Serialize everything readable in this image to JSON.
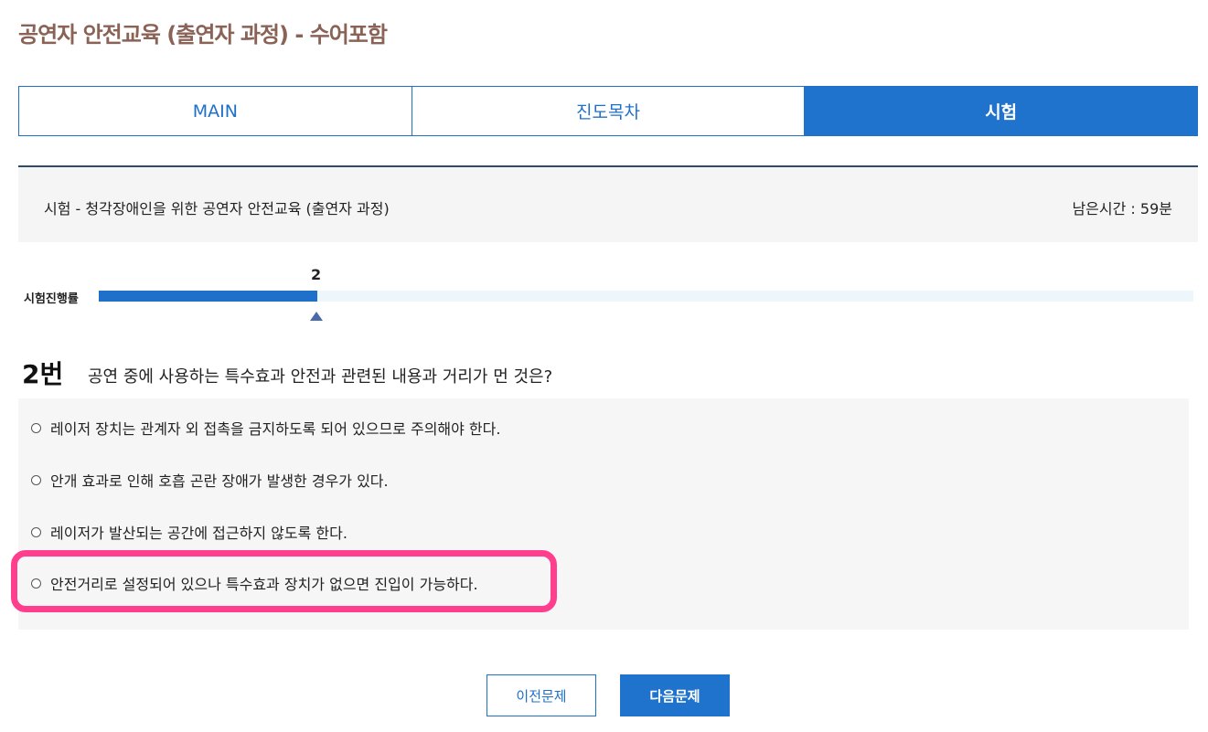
{
  "page": {
    "title": "공연자 안전교육 (출연자 과정) - 수어포함"
  },
  "tabs": [
    {
      "label": "MAIN",
      "active": false
    },
    {
      "label": "진도목차",
      "active": false
    },
    {
      "label": "시험",
      "active": true
    }
  ],
  "exam": {
    "title": "시험 - 청각장애인을 위한 공연자 안전교육 (출연자 과정)",
    "time_label": "남은시간 : ",
    "time_value": "59분"
  },
  "progress": {
    "label": "시험진행률",
    "current": "2",
    "fraction": 0.2
  },
  "question": {
    "number": "2번",
    "text": "공연 중에 사용하는 특수효과 안전과 관련된 내용과 거리가 먼 것은?",
    "options": [
      {
        "text": "레이저 장치는 관계자 외 접촉을 금지하도록 되어 있으므로 주의해야 한다.",
        "selected": false
      },
      {
        "text": "안개 효과로 인해 호흡 곤란 장애가 발생한 경우가 있다.",
        "selected": false
      },
      {
        "text": "레이저가 발산되는 공간에 접근하지 않도록 한다.",
        "selected": false
      },
      {
        "text": "안전거리로 설정되어 있으나 특수효과 장치가 없으면 진입이 가능하다.",
        "selected": false,
        "highlighted": true
      }
    ]
  },
  "buttons": {
    "prev": "이전문제",
    "next": "다음문제"
  },
  "colors": {
    "accent": "#1f73cc",
    "title": "#8a6256",
    "highlight": "#ff3f8e",
    "progress_track": "#edf6fb"
  }
}
